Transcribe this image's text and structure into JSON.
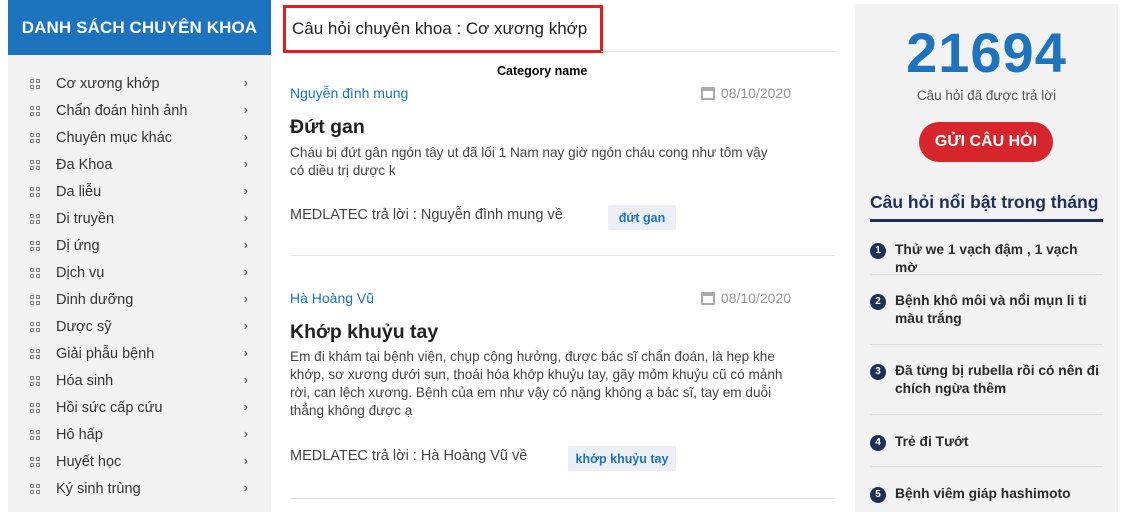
{
  "sidebar": {
    "title": "DANH SÁCH CHUYÊN KHOA",
    "items": [
      {
        "label": "Cơ xương khớp"
      },
      {
        "label": "Chẩn đoán hình ảnh"
      },
      {
        "label": "Chuyên mục khác"
      },
      {
        "label": "Đa Khoa"
      },
      {
        "label": "Da liễu"
      },
      {
        "label": "Di truyền"
      },
      {
        "label": "Dị ứng"
      },
      {
        "label": "Dịch vụ"
      },
      {
        "label": "Dinh dưỡng"
      },
      {
        "label": "Dược sỹ"
      },
      {
        "label": "Giải phẫu bệnh"
      },
      {
        "label": "Hóa sinh"
      },
      {
        "label": "Hồi sức cấp cứu"
      },
      {
        "label": "Hô hấp"
      },
      {
        "label": "Huyết học"
      },
      {
        "label": "Ký sinh trùng"
      }
    ],
    "chevron": "›"
  },
  "main": {
    "category_title": "Câu hỏi chuyên khoa : Cơ xương khớp",
    "category_note": "Category name",
    "questions": [
      {
        "author": "Nguyễn đình mung",
        "date": "08/10/2020",
        "title": "Đứt gan",
        "body_lines": [
          "Cháu bị đứt gân ngón tây ut đã lối 1 Nam nay giờ ngón cháu cong như tôm vậy",
          "có diều trị dược k"
        ],
        "answer": "MEDLATEC trả lời : Nguyễn đình mung về",
        "tag": "đứt gan"
      },
      {
        "author": "Hà Hoàng Vũ",
        "date": "08/10/2020",
        "title": "Khớp khuỷu tay",
        "body_lines": [
          "Em đi khám tại bệnh viện, chụp cộng hưởng, được bác sĩ chẩn đoán, là hẹp khe",
          "khớp, sơ xương dưới sụn, thoái hóa khớp khuỷu tay, gãy mỏm khuỷu cũ có mảnh",
          "rời, can lệch xương. Bệnh của em như vậy có nặng không ạ bác sĩ, tay em duỗi",
          "thẳng không được ạ"
        ],
        "answer": "MEDLATEC trả lời : Hà Hoàng Vũ về",
        "tag": "khớp khuỷu tay"
      }
    ]
  },
  "right": {
    "count": "21694",
    "count_label": "Câu hỏi đã được trả lời",
    "ask_button": "GỬI CÂU HỎI",
    "hot_title": "Câu hỏi nổi bật trong tháng",
    "hot_items": [
      {
        "num": "1",
        "text": "Thử we 1 vạch đậm , 1 vạch mờ"
      },
      {
        "num": "2",
        "text": "Bệnh khô môi và nổi mụn li ti màu trắng"
      },
      {
        "num": "3",
        "text": "Đã từng bị rubella rồi có nên đi chích ngừa thêm"
      },
      {
        "num": "4",
        "text": "Trẻ đi Tướt"
      },
      {
        "num": "5",
        "text": "Bệnh viêm giáp hashimoto"
      }
    ]
  },
  "colors": {
    "brand_blue": "#1e73be",
    "red": "#d6262c",
    "navy": "#1d2f5a"
  },
  "icons": {
    "sidebar_item": "grid-icon",
    "chevron": "chevron-right-icon",
    "date": "calendar-icon"
  }
}
